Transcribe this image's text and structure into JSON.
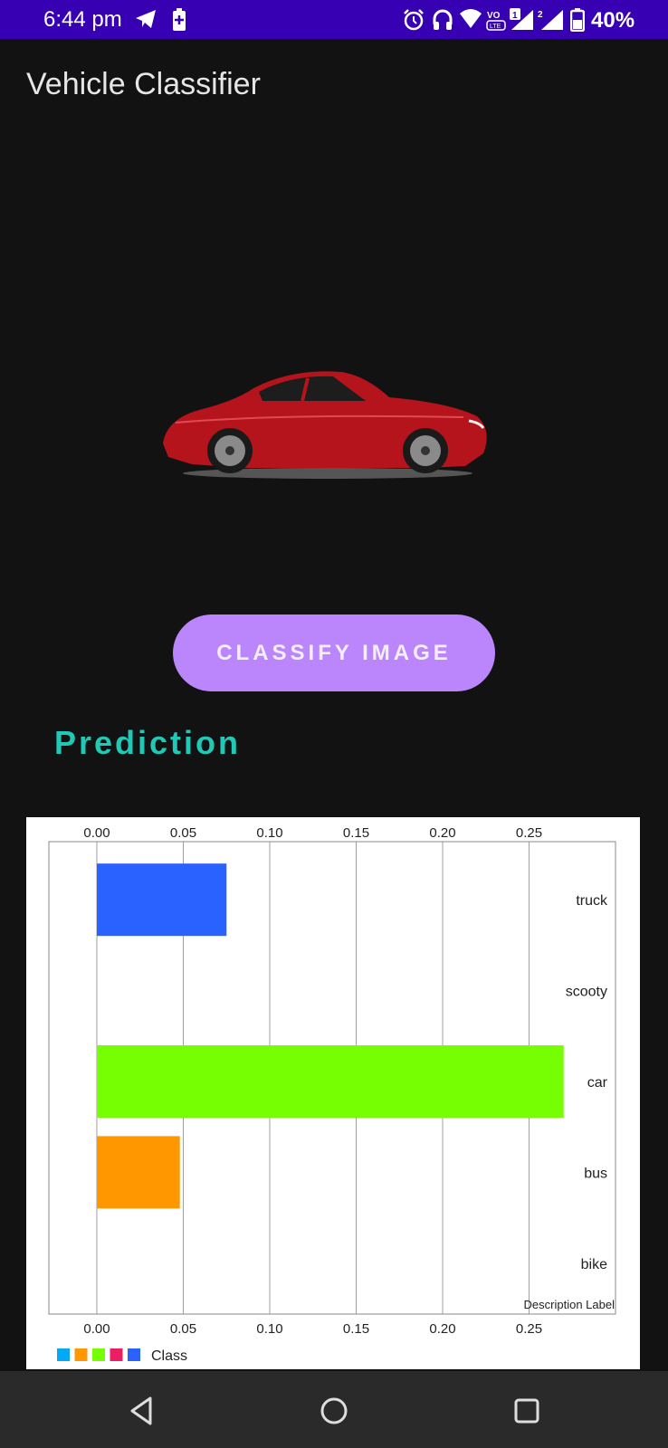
{
  "status_bar": {
    "time": "6:44 pm",
    "battery": "40%",
    "icons": [
      "telegram-icon",
      "battery-saver-icon",
      "alarm-icon",
      "headphones-icon",
      "wifi-icon",
      "volte-icon",
      "signal-sim1-icon",
      "signal-sim2-icon",
      "battery-icon"
    ],
    "background": "#3700b3"
  },
  "app": {
    "title": "Vehicle Classifier",
    "button_label": "CLASSIFY IMAGE",
    "prediction_heading": "Prediction",
    "colors": {
      "button": "#bb86fc",
      "prediction": "#1fc9b6",
      "background": "#121212"
    }
  },
  "chart_data": {
    "type": "bar",
    "orientation": "horizontal",
    "categories": [
      "truck",
      "scooty",
      "car",
      "bus",
      "bike"
    ],
    "values": [
      0.075,
      0,
      0.27,
      0.048,
      0
    ],
    "bar_colors": [
      "#2962ff",
      "#03a9f4",
      "#76ff03",
      "#ff9800",
      "#e91e63"
    ],
    "xlim": [
      0,
      0.3
    ],
    "x_ticks": [
      "0.00",
      "0.05",
      "0.10",
      "0.15",
      "0.20",
      "0.25"
    ],
    "description": "Description Label",
    "legend_label": "Class",
    "legend_colors": [
      "#03a9f4",
      "#ff9800",
      "#76ff03",
      "#e91e63",
      "#2962ff"
    ],
    "grid": true
  },
  "nav_bar": {
    "icons": [
      "back-icon",
      "home-icon",
      "recents-icon"
    ]
  }
}
